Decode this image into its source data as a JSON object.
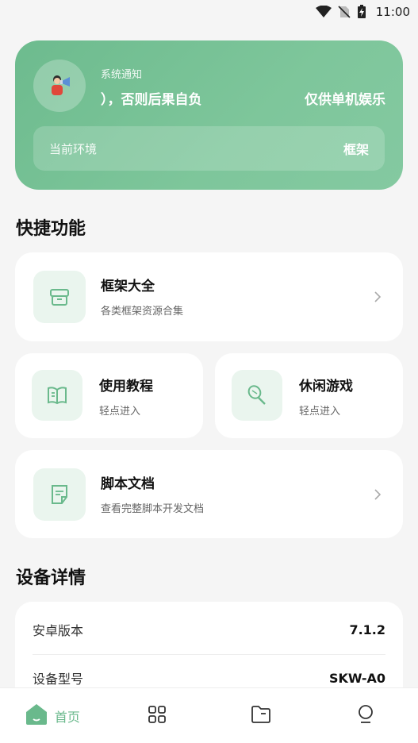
{
  "status_bar": {
    "time": "11:00",
    "icons": [
      "wifi-icon",
      "no-sim-icon",
      "battery-charging-icon"
    ]
  },
  "notice": {
    "label": "系统通知",
    "text_left": "），否则后果自负",
    "text_right": "仅供单机娱乐",
    "env_label": "当前环境",
    "env_value": "框架"
  },
  "quick": {
    "title": "快捷功能",
    "framework": {
      "title": "框架大全",
      "sub": "各类框架资源合集",
      "icon": "archive-box-icon"
    },
    "tutorial": {
      "title": "使用教程",
      "sub": "轻点进入",
      "icon": "book-icon"
    },
    "games": {
      "title": "休闲游戏",
      "sub": "轻点进入",
      "icon": "tennis-racket-icon"
    },
    "docs": {
      "title": "脚本文档",
      "sub": "查看完整脚本开发文档",
      "icon": "document-icon"
    }
  },
  "device": {
    "title": "设备详情",
    "rows": [
      {
        "key": "安卓版本",
        "value": "7.1.2"
      },
      {
        "key": "设备型号",
        "value": "SKW-A0"
      }
    ]
  },
  "tabbar": {
    "home_label": "首页",
    "tabs": [
      "home-icon",
      "grid-icon",
      "folder-icon",
      "profile-icon"
    ]
  },
  "colors": {
    "accent": "#6ab98c",
    "card_bg": "#ffffff",
    "icon_bg": "#eaf5ee"
  }
}
